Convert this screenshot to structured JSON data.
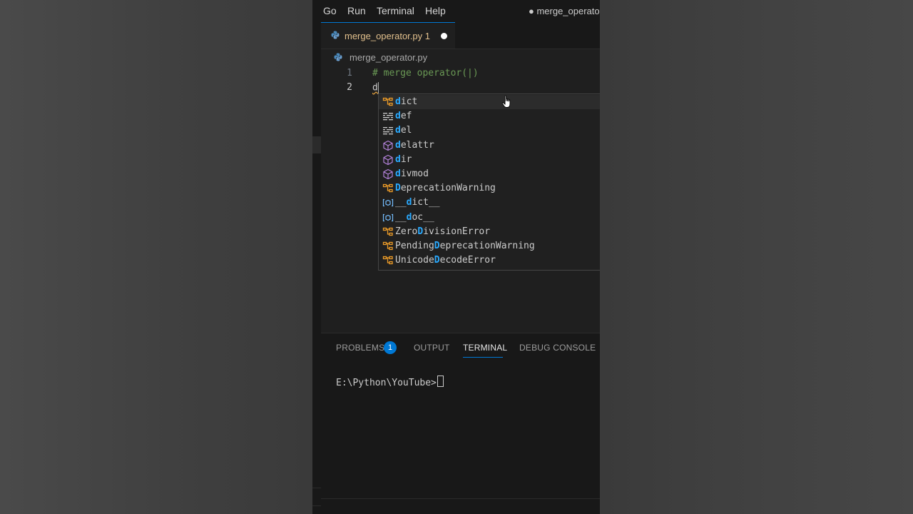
{
  "menubar": {
    "items": [
      "Go",
      "Run",
      "Terminal",
      "Help"
    ],
    "title": "● merge_operator"
  },
  "tab": {
    "label": "merge_operator.py 1",
    "icon": "python-file-icon",
    "modified": true
  },
  "breadcrumb": {
    "file": "merge_operator.py"
  },
  "editor": {
    "lines": [
      {
        "number": "1",
        "text": "# merge operator(|)"
      },
      {
        "number": "2",
        "text": "d"
      }
    ]
  },
  "suggestions": [
    {
      "pre": "",
      "match": "d",
      "post": "ict",
      "kind": "class",
      "selected": true
    },
    {
      "pre": "",
      "match": "d",
      "post": "ef",
      "kind": "keyword"
    },
    {
      "pre": "",
      "match": "d",
      "post": "el",
      "kind": "keyword"
    },
    {
      "pre": "",
      "match": "d",
      "post": "elattr",
      "kind": "function"
    },
    {
      "pre": "",
      "match": "d",
      "post": "ir",
      "kind": "function"
    },
    {
      "pre": "",
      "match": "d",
      "post": "ivmod",
      "kind": "function"
    },
    {
      "pre": "",
      "match": "D",
      "post": "eprecationWarning",
      "kind": "class"
    },
    {
      "pre": "__",
      "match": "d",
      "post": "ict__",
      "kind": "variable"
    },
    {
      "pre": "__",
      "match": "d",
      "post": "oc__",
      "kind": "variable"
    },
    {
      "pre": "Zero",
      "match": "D",
      "post": "ivisionError",
      "kind": "class"
    },
    {
      "pre": "Pending",
      "match": "D",
      "post": "eprecationWarning",
      "kind": "class"
    },
    {
      "pre": "Unicode",
      "match": "D",
      "post": "ecodeError",
      "kind": "class"
    }
  ],
  "panel": {
    "tabs": [
      {
        "label": "PROBLEMS",
        "active": false
      },
      {
        "label": "OUTPUT",
        "active": false
      },
      {
        "label": "TERMINAL",
        "active": true
      },
      {
        "label": "DEBUG CONSOLE",
        "active": false
      }
    ],
    "problems_badge": "1",
    "terminal_prompt": "E:\\Python\\YouTube>"
  },
  "colors": {
    "accent": "#0078d4",
    "modified_tab": "#e2c08d",
    "comment": "#6a9955",
    "match_highlight": "#2aaaff"
  }
}
